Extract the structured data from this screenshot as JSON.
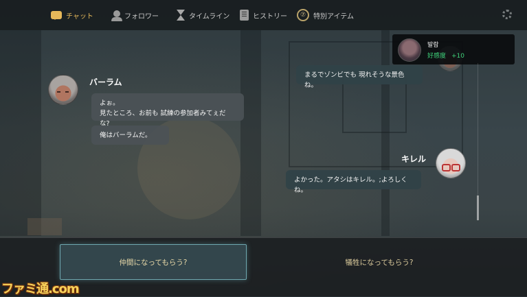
{
  "nav": {
    "tabs": [
      {
        "label": "チャット",
        "icon": "chat-icon",
        "active": true
      },
      {
        "label": "フォロワー",
        "icon": "follower-icon",
        "active": false
      },
      {
        "label": "タイムライン",
        "icon": "hourglass-icon",
        "active": false
      },
      {
        "label": "ヒストリー",
        "icon": "book-icon",
        "active": false
      },
      {
        "label": "特別アイテム",
        "icon": "special-item-icon",
        "active": false
      }
    ],
    "item_icon_glyph": "⑦",
    "accent_color": "#e6b85a"
  },
  "notification": {
    "name": "발람",
    "stat_label": "好感度",
    "stat_value": "+10",
    "stat_color": "#3fd27a"
  },
  "chat": {
    "left_speaker": "バーラム",
    "left_messages": [
      "よぉ。\n見たところ、お前も 試練の参加者みてぇだな?",
      "俺はバーラムだ。"
    ],
    "right_top_message": "まるでゾンビでも 現れそうな景色ね。",
    "right_speaker": "キレル",
    "right_messages": [
      "よかった。アタシはキレル。;よろしくね。"
    ]
  },
  "choices": {
    "selected": "仲間になってもらう?",
    "other": "犠牲になってもらう?"
  },
  "watermark": "ファミ通.com"
}
